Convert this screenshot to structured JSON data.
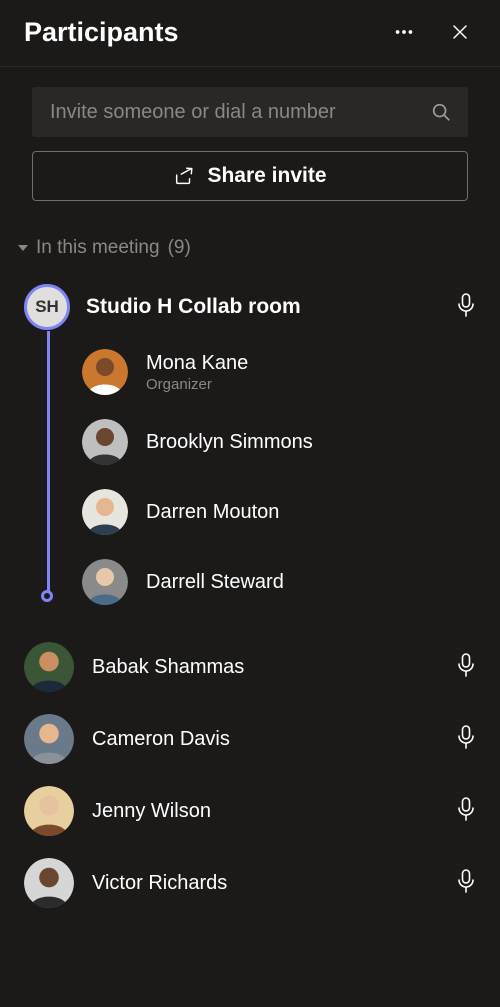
{
  "header": {
    "title": "Participants"
  },
  "invite": {
    "placeholder": "Invite someone or dial a number",
    "share_label": "Share invite"
  },
  "section": {
    "label": "In this meeting",
    "count": "(9)"
  },
  "room": {
    "initials": "SH",
    "name": "Studio H Collab room",
    "members": [
      {
        "name": "Mona Kane",
        "role": "Organizer",
        "avatar": "mona"
      },
      {
        "name": "Brooklyn Simmons",
        "role": "",
        "avatar": "brooklyn"
      },
      {
        "name": "Darren Mouton",
        "role": "",
        "avatar": "darren"
      },
      {
        "name": "Darrell Steward",
        "role": "",
        "avatar": "darrell"
      }
    ]
  },
  "participants": [
    {
      "name": "Babak Shammas",
      "avatar": "babak"
    },
    {
      "name": "Cameron Davis",
      "avatar": "cameron"
    },
    {
      "name": "Jenny Wilson",
      "avatar": "jenny"
    },
    {
      "name": "Victor Richards",
      "avatar": "victor"
    }
  ],
  "avatar_palette": {
    "mona": {
      "bg": "#c9782d",
      "skin": "#7a4a2a",
      "shirt": "#ffffff"
    },
    "brooklyn": {
      "bg": "#bfbfbf",
      "skin": "#6a4631",
      "shirt": "#333333"
    },
    "darren": {
      "bg": "#e8e4de",
      "skin": "#e6b78f",
      "shirt": "#2c3e50"
    },
    "darrell": {
      "bg": "#8a8a8a",
      "skin": "#e6c9a8",
      "shirt": "#4a6b8a"
    },
    "babak": {
      "bg": "#3b5636",
      "skin": "#c98f62",
      "shirt": "#1b2a3a"
    },
    "cameron": {
      "bg": "#6b7a8a",
      "skin": "#e6b78f",
      "shirt": "#8a9299"
    },
    "jenny": {
      "bg": "#e8cfa0",
      "skin": "#e6c2a0",
      "shirt": "#7a4a2a"
    },
    "victor": {
      "bg": "#d6d6d6",
      "skin": "#6a4631",
      "shirt": "#2b2b2b"
    }
  }
}
